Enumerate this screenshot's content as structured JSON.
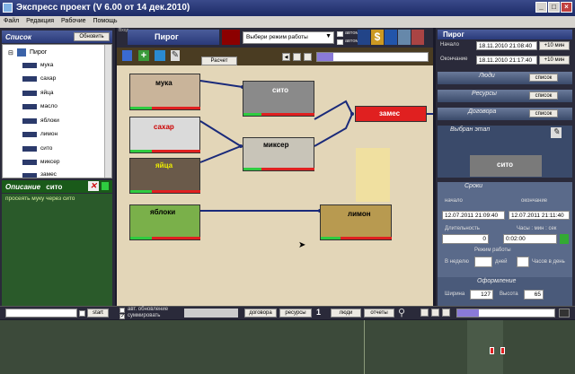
{
  "window": {
    "title": "Экспресс проект (V 6.00 от 14 дек.2010)"
  },
  "menu": [
    "Файл",
    "Редакция",
    "Рабочие",
    "Помощь"
  ],
  "left": {
    "list_header": "Список",
    "refresh_label": "Обновить",
    "root_item": "Пирог",
    "tree_items": [
      "мука",
      "сахар",
      "яйца",
      "масло",
      "яблоки",
      "лимон",
      "сито",
      "миксер",
      "замес"
    ],
    "desc_header": "Описание",
    "desc_item": "сито",
    "desc_text": "просеять муку через сито"
  },
  "center": {
    "caption": "Вход",
    "project_title": "Пирог",
    "mode_select": "Выбери режим работы",
    "auto_label_1": "автом",
    "auto_label_2": "автом",
    "calc_button": "Расчет",
    "nodes": {
      "muka": "мука",
      "sito": "сито",
      "sahar": "сахар",
      "mixer": "миксер",
      "yaica": "яйца",
      "zames": "замес",
      "yabloki": "яблоки",
      "limon": "лимон"
    }
  },
  "right": {
    "title": "Пирог",
    "start_label": "Начало",
    "start_value": "18.11.2010 21:08:40",
    "start_btn": "+10 мин",
    "end_label": "Окончание",
    "end_value": "18.11.2010 21:17:40",
    "end_btn": "+10 мин",
    "sections": {
      "people": "Люди",
      "resources": "Ресурсы",
      "contracts": "Договора",
      "stage": "Выбран этап"
    },
    "list_btn": "список",
    "stage_item": "сито",
    "terms": "Сроки",
    "start_short": "начало",
    "end_short": "окончание",
    "term_start": "12.07.2011 21:09:40",
    "term_end": "12.07.2011 21:11:40",
    "duration_days_label": "Длительность",
    "duration_days_value": "0",
    "duration_time_label": "Часы : мин : сек",
    "duration_time_value": "0:02:00",
    "work_mode_label": "Режим работы",
    "per_week_label": "В неделю",
    "days_label": "дней",
    "hours_label": "Часов в день",
    "design": "Оформление",
    "width_label": "Ширина",
    "width_value": "127",
    "height_label": "Высота",
    "height_value": "65"
  },
  "bottom": {
    "start_btn": "start",
    "auto_update": "авт. обновление",
    "summarize": "суммировать",
    "contracts_btn": "договора",
    "resources_btn": "ресурсы",
    "page_num": "1",
    "people_btn": "люди",
    "reports_btn": "отчеты",
    "progress": 0.22
  }
}
